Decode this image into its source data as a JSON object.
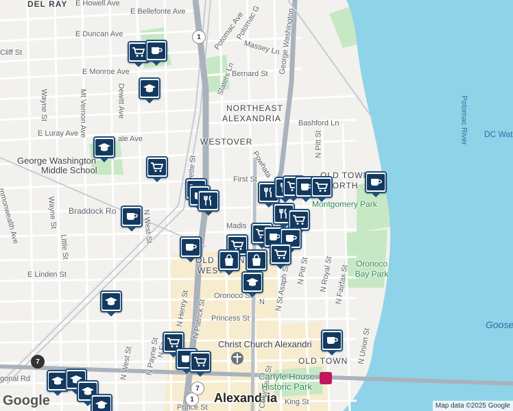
{
  "map": {
    "neighborhoods": {
      "del_ray": "DEL RAY",
      "northeast_1": "NORTHEAST",
      "northeast_2": "ALEXANDRIA",
      "westover": "WESTOVER",
      "old_town_north_1": "OLD TOWN",
      "old_town_north_2": "NORTH",
      "old_town_west_1": "OLD TOWN",
      "old_town_west_2": "WEST",
      "old_town": "OLD TOWN",
      "city": "Alexandria"
    },
    "streets": {
      "e_howell": "E Howell Ave",
      "e_bellefonte": "E Bellefonte Ave",
      "e_duncan": "E Duncan Ave",
      "cliff": "Cliff St",
      "e_monroe": "E Monroe Ave",
      "wayne_n": "Wayne St",
      "dewitt": "Dewitt Ave",
      "mt_vernon": "Mt Vernon Ave",
      "e_luray": "E Luray Ave",
      "ale_ave": "ale Ave",
      "potomac_ave": "Potomac Ave",
      "potomac_g": "Potomac G",
      "massey": "Massey Ln",
      "slaters": "Slaters Ln",
      "bernard": "Bernard St",
      "gw_pkwy": "George Washington",
      "bashford": "Bashford Ln",
      "n_pitt_top": "N Pitt St",
      "powhatan": "Powhata",
      "first_st": "First St",
      "n_fayette_top": "yette St",
      "braddock": "Braddock Ro",
      "madison": "Madis",
      "commonwealth": "mmonwealth Ave",
      "wayne_s": "Wayne St",
      "little": "Little St",
      "e_linden": "E Linden St",
      "n_west_top": "N West St",
      "n_henry": "N Henry St",
      "n_patrick": "N Patrick St",
      "oronoco": "Oronoco St",
      "princess": "Princess St",
      "n_st_asaph": "N St Asaph St",
      "n_pitt_bot": "N Pitt St",
      "n_royal": "N Royal St",
      "n_fairfax": "N Fairfax St",
      "n_union": "N Union St",
      "n_west_bot": "N West St",
      "n_payne": "N Payne St",
      "n_fa": "N Fa",
      "n_columbus": "N Columbus St",
      "king": "King St",
      "prince": "Prince St",
      "gonal": "gonal Rd",
      "n": "N"
    },
    "parks": {
      "montgomery": "Montgomery Park",
      "oronoco_bay": "Oronoco Bay Park",
      "carlyle": "Carlyle House Historic Park"
    },
    "water": {
      "potomac": "Potomac River",
      "dc_wat": "DC Wat",
      "goose": "Goose"
    },
    "poi": {
      "school": "George Washington Middle School",
      "christ_church": "Christ Church Alexandri"
    },
    "shields": {
      "us1": "1",
      "va7": "7"
    },
    "google_logo": "Google",
    "attribution": "Map data ©2025 Google",
    "pin_types": [
      "shopping-cart",
      "coffee-cup",
      "graduation-cap",
      "fork-knife",
      "shopping-bag"
    ],
    "colors": {
      "land": "#f2f1ee",
      "water": "#8fd3e8",
      "park": "#c7e8c4",
      "highway": "#a9b2bd",
      "pin_border": "#1f4e7a",
      "pin_fill": "#14395e",
      "downtown": "#f7ecce"
    }
  }
}
